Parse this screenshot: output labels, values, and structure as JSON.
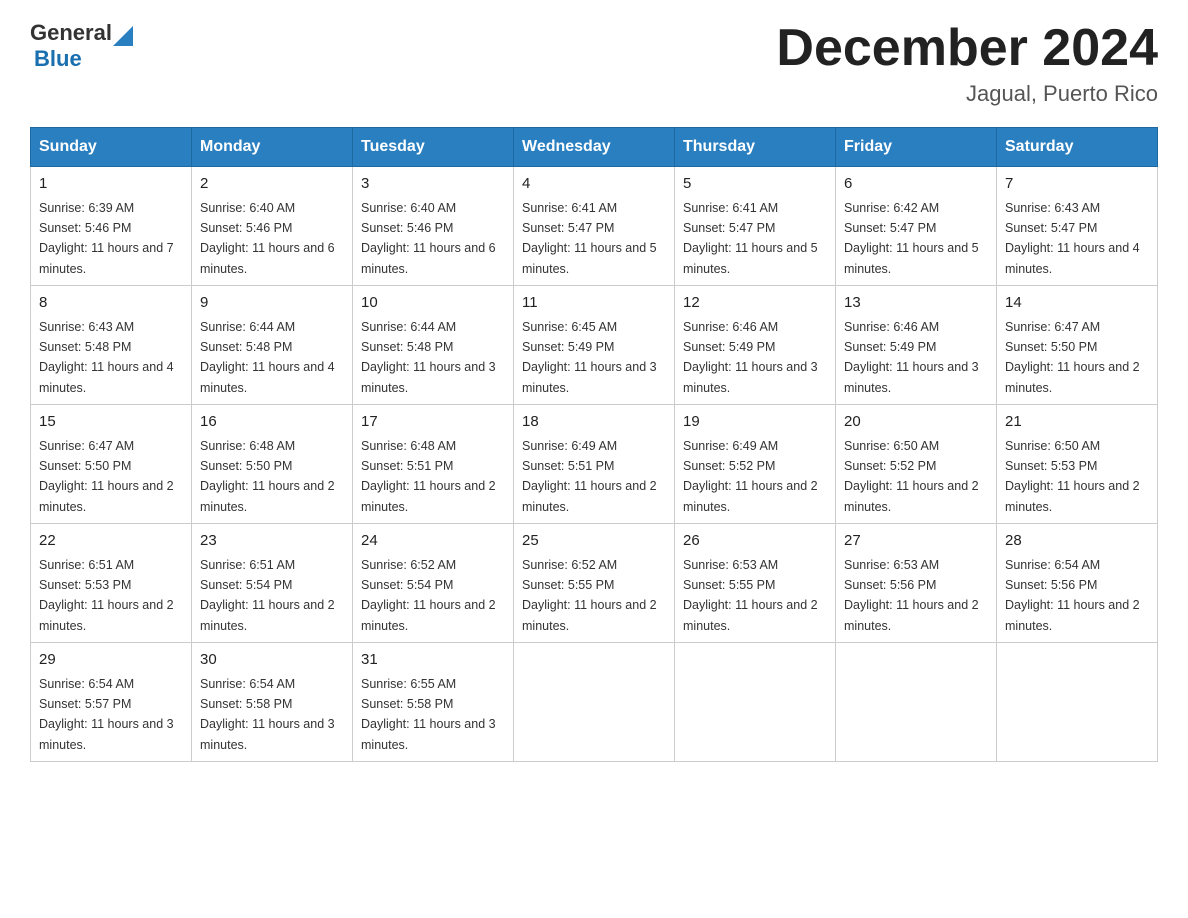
{
  "logo": {
    "text_general": "General",
    "text_blue": "Blue",
    "aria": "GeneralBlue logo"
  },
  "title": "December 2024",
  "subtitle": "Jagual, Puerto Rico",
  "days_of_week": [
    "Sunday",
    "Monday",
    "Tuesday",
    "Wednesday",
    "Thursday",
    "Friday",
    "Saturday"
  ],
  "weeks": [
    [
      {
        "day": "1",
        "sunrise": "Sunrise: 6:39 AM",
        "sunset": "Sunset: 5:46 PM",
        "daylight": "Daylight: 11 hours and 7 minutes."
      },
      {
        "day": "2",
        "sunrise": "Sunrise: 6:40 AM",
        "sunset": "Sunset: 5:46 PM",
        "daylight": "Daylight: 11 hours and 6 minutes."
      },
      {
        "day": "3",
        "sunrise": "Sunrise: 6:40 AM",
        "sunset": "Sunset: 5:46 PM",
        "daylight": "Daylight: 11 hours and 6 minutes."
      },
      {
        "day": "4",
        "sunrise": "Sunrise: 6:41 AM",
        "sunset": "Sunset: 5:47 PM",
        "daylight": "Daylight: 11 hours and 5 minutes."
      },
      {
        "day": "5",
        "sunrise": "Sunrise: 6:41 AM",
        "sunset": "Sunset: 5:47 PM",
        "daylight": "Daylight: 11 hours and 5 minutes."
      },
      {
        "day": "6",
        "sunrise": "Sunrise: 6:42 AM",
        "sunset": "Sunset: 5:47 PM",
        "daylight": "Daylight: 11 hours and 5 minutes."
      },
      {
        "day": "7",
        "sunrise": "Sunrise: 6:43 AM",
        "sunset": "Sunset: 5:47 PM",
        "daylight": "Daylight: 11 hours and 4 minutes."
      }
    ],
    [
      {
        "day": "8",
        "sunrise": "Sunrise: 6:43 AM",
        "sunset": "Sunset: 5:48 PM",
        "daylight": "Daylight: 11 hours and 4 minutes."
      },
      {
        "day": "9",
        "sunrise": "Sunrise: 6:44 AM",
        "sunset": "Sunset: 5:48 PM",
        "daylight": "Daylight: 11 hours and 4 minutes."
      },
      {
        "day": "10",
        "sunrise": "Sunrise: 6:44 AM",
        "sunset": "Sunset: 5:48 PM",
        "daylight": "Daylight: 11 hours and 3 minutes."
      },
      {
        "day": "11",
        "sunrise": "Sunrise: 6:45 AM",
        "sunset": "Sunset: 5:49 PM",
        "daylight": "Daylight: 11 hours and 3 minutes."
      },
      {
        "day": "12",
        "sunrise": "Sunrise: 6:46 AM",
        "sunset": "Sunset: 5:49 PM",
        "daylight": "Daylight: 11 hours and 3 minutes."
      },
      {
        "day": "13",
        "sunrise": "Sunrise: 6:46 AM",
        "sunset": "Sunset: 5:49 PM",
        "daylight": "Daylight: 11 hours and 3 minutes."
      },
      {
        "day": "14",
        "sunrise": "Sunrise: 6:47 AM",
        "sunset": "Sunset: 5:50 PM",
        "daylight": "Daylight: 11 hours and 2 minutes."
      }
    ],
    [
      {
        "day": "15",
        "sunrise": "Sunrise: 6:47 AM",
        "sunset": "Sunset: 5:50 PM",
        "daylight": "Daylight: 11 hours and 2 minutes."
      },
      {
        "day": "16",
        "sunrise": "Sunrise: 6:48 AM",
        "sunset": "Sunset: 5:50 PM",
        "daylight": "Daylight: 11 hours and 2 minutes."
      },
      {
        "day": "17",
        "sunrise": "Sunrise: 6:48 AM",
        "sunset": "Sunset: 5:51 PM",
        "daylight": "Daylight: 11 hours and 2 minutes."
      },
      {
        "day": "18",
        "sunrise": "Sunrise: 6:49 AM",
        "sunset": "Sunset: 5:51 PM",
        "daylight": "Daylight: 11 hours and 2 minutes."
      },
      {
        "day": "19",
        "sunrise": "Sunrise: 6:49 AM",
        "sunset": "Sunset: 5:52 PM",
        "daylight": "Daylight: 11 hours and 2 minutes."
      },
      {
        "day": "20",
        "sunrise": "Sunrise: 6:50 AM",
        "sunset": "Sunset: 5:52 PM",
        "daylight": "Daylight: 11 hours and 2 minutes."
      },
      {
        "day": "21",
        "sunrise": "Sunrise: 6:50 AM",
        "sunset": "Sunset: 5:53 PM",
        "daylight": "Daylight: 11 hours and 2 minutes."
      }
    ],
    [
      {
        "day": "22",
        "sunrise": "Sunrise: 6:51 AM",
        "sunset": "Sunset: 5:53 PM",
        "daylight": "Daylight: 11 hours and 2 minutes."
      },
      {
        "day": "23",
        "sunrise": "Sunrise: 6:51 AM",
        "sunset": "Sunset: 5:54 PM",
        "daylight": "Daylight: 11 hours and 2 minutes."
      },
      {
        "day": "24",
        "sunrise": "Sunrise: 6:52 AM",
        "sunset": "Sunset: 5:54 PM",
        "daylight": "Daylight: 11 hours and 2 minutes."
      },
      {
        "day": "25",
        "sunrise": "Sunrise: 6:52 AM",
        "sunset": "Sunset: 5:55 PM",
        "daylight": "Daylight: 11 hours and 2 minutes."
      },
      {
        "day": "26",
        "sunrise": "Sunrise: 6:53 AM",
        "sunset": "Sunset: 5:55 PM",
        "daylight": "Daylight: 11 hours and 2 minutes."
      },
      {
        "day": "27",
        "sunrise": "Sunrise: 6:53 AM",
        "sunset": "Sunset: 5:56 PM",
        "daylight": "Daylight: 11 hours and 2 minutes."
      },
      {
        "day": "28",
        "sunrise": "Sunrise: 6:54 AM",
        "sunset": "Sunset: 5:56 PM",
        "daylight": "Daylight: 11 hours and 2 minutes."
      }
    ],
    [
      {
        "day": "29",
        "sunrise": "Sunrise: 6:54 AM",
        "sunset": "Sunset: 5:57 PM",
        "daylight": "Daylight: 11 hours and 3 minutes."
      },
      {
        "day": "30",
        "sunrise": "Sunrise: 6:54 AM",
        "sunset": "Sunset: 5:58 PM",
        "daylight": "Daylight: 11 hours and 3 minutes."
      },
      {
        "day": "31",
        "sunrise": "Sunrise: 6:55 AM",
        "sunset": "Sunset: 5:58 PM",
        "daylight": "Daylight: 11 hours and 3 minutes."
      },
      null,
      null,
      null,
      null
    ]
  ]
}
